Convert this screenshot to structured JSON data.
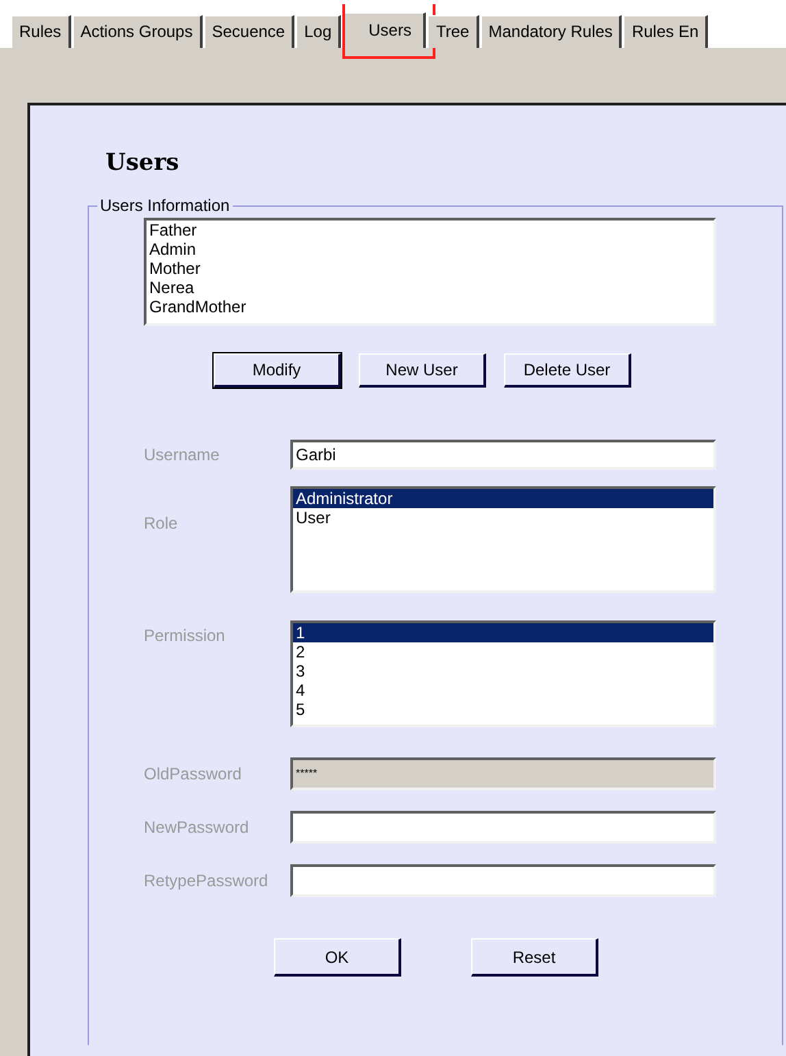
{
  "tabs": [
    {
      "label": "Rules",
      "selected": false,
      "highlighted": false
    },
    {
      "label": "Actions Groups",
      "selected": false,
      "highlighted": false
    },
    {
      "label": "Secuence",
      "selected": false,
      "highlighted": false
    },
    {
      "label": "Log",
      "selected": false,
      "highlighted": false
    },
    {
      "label": "Users",
      "selected": true,
      "highlighted": true
    },
    {
      "label": "Tree",
      "selected": false,
      "highlighted": false
    },
    {
      "label": "Mandatory Rules",
      "selected": false,
      "highlighted": false
    },
    {
      "label": "Rules En",
      "selected": false,
      "highlighted": false
    }
  ],
  "title": "Users",
  "users_information": {
    "legend": "Users Information",
    "users": [
      {
        "label": "Father",
        "selected": false
      },
      {
        "label": "Admin",
        "selected": false
      },
      {
        "label": "Mother",
        "selected": false
      },
      {
        "label": "Nerea",
        "selected": false
      },
      {
        "label": "GrandMother",
        "selected": false
      }
    ],
    "buttons": [
      {
        "label": "Modify",
        "default": true
      },
      {
        "label": "New User",
        "default": false
      },
      {
        "label": "Delete User",
        "default": false
      }
    ],
    "username": {
      "label": "Username",
      "value": "Garbi"
    },
    "role": {
      "label": "Role",
      "options": [
        {
          "label": "Administrator",
          "selected": true
        },
        {
          "label": "User",
          "selected": false
        }
      ]
    },
    "permission": {
      "label": "Permission",
      "options": [
        {
          "label": "1",
          "selected": true
        },
        {
          "label": "2",
          "selected": false
        },
        {
          "label": "3",
          "selected": false
        },
        {
          "label": "4",
          "selected": false
        },
        {
          "label": "5",
          "selected": false
        }
      ]
    },
    "old_password": {
      "label": "OldPassword",
      "value": "*****",
      "disabled": true
    },
    "new_password": {
      "label": "NewPassword",
      "disabled": false
    },
    "retype_password": {
      "label": "RetypePassword",
      "disabled": false
    },
    "actions": [
      {
        "label": "OK"
      },
      {
        "label": "Reset"
      }
    ]
  }
}
